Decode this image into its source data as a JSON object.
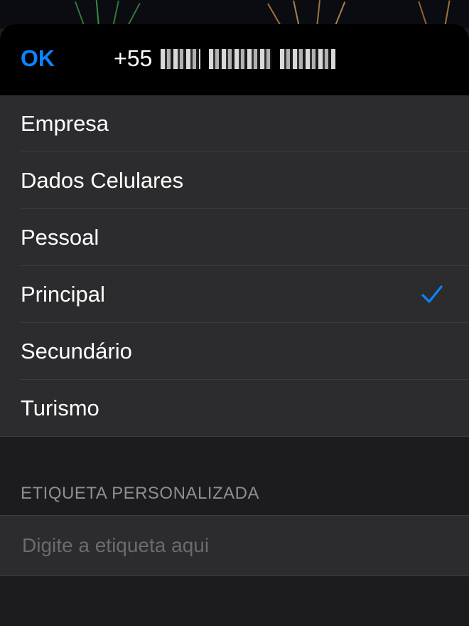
{
  "header": {
    "ok_label": "OK",
    "phone_prefix": "+55"
  },
  "options": [
    {
      "label": "Empresa",
      "selected": false
    },
    {
      "label": "Dados Celulares",
      "selected": false
    },
    {
      "label": "Pessoal",
      "selected": false
    },
    {
      "label": "Principal",
      "selected": true
    },
    {
      "label": "Secundário",
      "selected": false
    },
    {
      "label": "Turismo",
      "selected": false
    }
  ],
  "custom_label": {
    "section_title": "ETIQUETA PERSONALIZADA",
    "placeholder": "Digite a etiqueta aqui",
    "value": ""
  },
  "colors": {
    "accent": "#0a84ff",
    "background": "#1c1c1e",
    "cell": "#2c2c2e",
    "header": "#000000"
  }
}
